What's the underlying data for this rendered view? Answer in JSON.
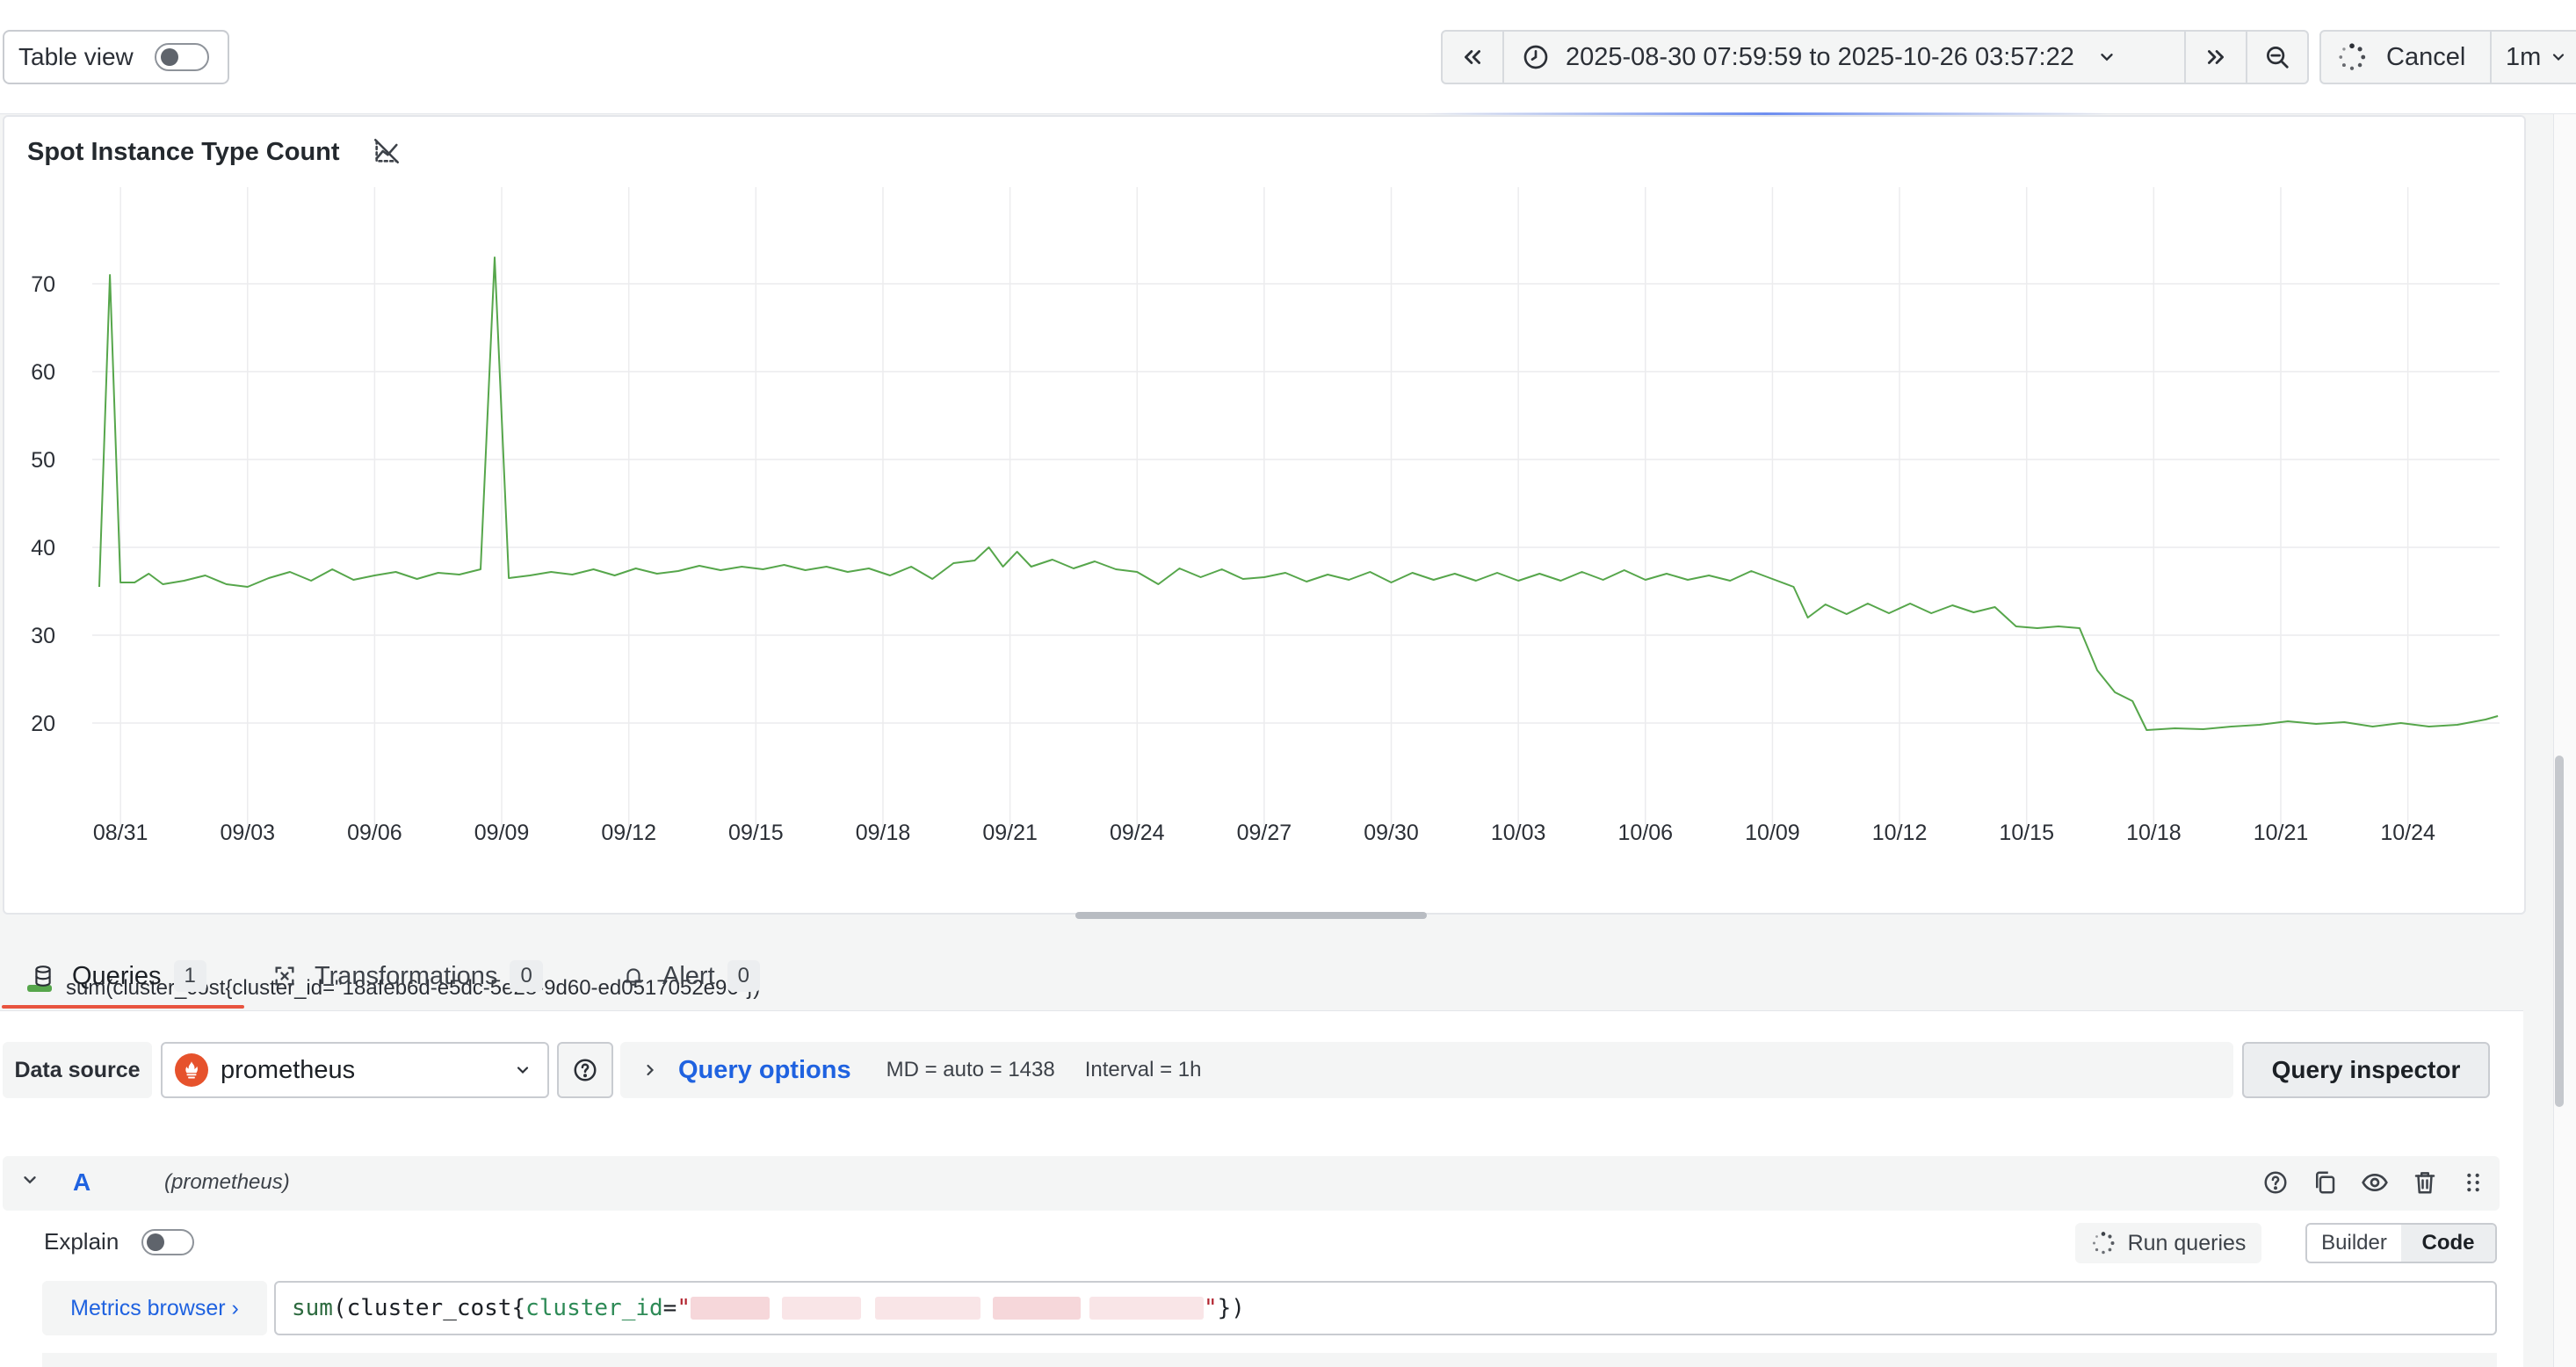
{
  "toolbar": {
    "table_view_label": "Table view",
    "time_range": "2025-08-30 07:59:59 to 2025-10-26 03:57:22",
    "cancel_label": "Cancel",
    "refresh_interval": "1m"
  },
  "panel": {
    "title": "Spot Instance Type Count",
    "legend_label": "sum(cluster_cost{cluster_id=\"18afeb6d-e5dc-5e28-9d60-ed0517052e96\"})"
  },
  "chart_data": {
    "type": "line",
    "x_ticks": [
      "08/31",
      "09/03",
      "09/06",
      "09/09",
      "09/12",
      "09/15",
      "09/18",
      "09/21",
      "09/24",
      "09/27",
      "09/30",
      "10/03",
      "10/06",
      "10/09",
      "10/12",
      "10/15",
      "10/18",
      "10/21",
      "10/24"
    ],
    "y_ticks": [
      20,
      30,
      40,
      50,
      60,
      70
    ],
    "ylim": [
      12,
      79
    ],
    "grid": true,
    "series": [
      {
        "name": "sum(cluster_cost{cluster_id=\"18afeb6d-e5dc-5e28-9d60-ed0517052e96\"})",
        "color": "#56a64b",
        "points": [
          [
            "08/30 12:00",
            35.5
          ],
          [
            "08/30 18:00",
            71
          ],
          [
            "08/31 00:00",
            36
          ],
          [
            "08/31 08:00",
            36
          ],
          [
            "08/31 16:00",
            37
          ],
          [
            "09/01 00:00",
            35.8
          ],
          [
            "09/01 12:00",
            36.2
          ],
          [
            "09/02 00:00",
            36.8
          ],
          [
            "09/02 12:00",
            35.8
          ],
          [
            "09/03 00:00",
            35.5
          ],
          [
            "09/03 12:00",
            36.5
          ],
          [
            "09/04 00:00",
            37.2
          ],
          [
            "09/04 12:00",
            36.2
          ],
          [
            "09/05 00:00",
            37.5
          ],
          [
            "09/05 12:00",
            36.3
          ],
          [
            "09/06 00:00",
            36.8
          ],
          [
            "09/06 12:00",
            37.2
          ],
          [
            "09/07 00:00",
            36.4
          ],
          [
            "09/07 12:00",
            37.1
          ],
          [
            "09/08 00:00",
            36.9
          ],
          [
            "09/08 12:00",
            37.5
          ],
          [
            "09/08 20:00",
            73
          ],
          [
            "09/09 04:00",
            36.5
          ],
          [
            "09/09 16:00",
            36.8
          ],
          [
            "09/10 04:00",
            37.2
          ],
          [
            "09/10 16:00",
            36.9
          ],
          [
            "09/11 04:00",
            37.5
          ],
          [
            "09/11 16:00",
            36.8
          ],
          [
            "09/12 04:00",
            37.6
          ],
          [
            "09/12 16:00",
            37.0
          ],
          [
            "09/13 04:00",
            37.3
          ],
          [
            "09/13 16:00",
            37.9
          ],
          [
            "09/14 04:00",
            37.4
          ],
          [
            "09/14 16:00",
            37.8
          ],
          [
            "09/15 04:00",
            37.5
          ],
          [
            "09/15 16:00",
            38
          ],
          [
            "09/16 04:00",
            37.4
          ],
          [
            "09/16 16:00",
            37.8
          ],
          [
            "09/17 04:00",
            37.2
          ],
          [
            "09/17 16:00",
            37.6
          ],
          [
            "09/18 04:00",
            36.8
          ],
          [
            "09/18 16:00",
            37.8
          ],
          [
            "09/19 04:00",
            36.4
          ],
          [
            "09/19 16:00",
            38.2
          ],
          [
            "09/20 04:00",
            38.5
          ],
          [
            "09/20 12:00",
            40
          ],
          [
            "09/20 20:00",
            37.8
          ],
          [
            "09/21 04:00",
            39.5
          ],
          [
            "09/21 12:00",
            37.8
          ],
          [
            "09/22 00:00",
            38.6
          ],
          [
            "09/22 12:00",
            37.6
          ],
          [
            "09/23 00:00",
            38.4
          ],
          [
            "09/23 12:00",
            37.5
          ],
          [
            "09/24 00:00",
            37.2
          ],
          [
            "09/24 12:00",
            35.8
          ],
          [
            "09/25 00:00",
            37.6
          ],
          [
            "09/25 12:00",
            36.6
          ],
          [
            "09/26 00:00",
            37.5
          ],
          [
            "09/26 12:00",
            36.4
          ],
          [
            "09/27 00:00",
            36.6
          ],
          [
            "09/27 12:00",
            37.1
          ],
          [
            "09/28 00:00",
            36.1
          ],
          [
            "09/28 12:00",
            36.9
          ],
          [
            "09/29 00:00",
            36.3
          ],
          [
            "09/29 12:00",
            37.2
          ],
          [
            "09/30 00:00",
            36.0
          ],
          [
            "09/30 12:00",
            37.1
          ],
          [
            "10/01 00:00",
            36.3
          ],
          [
            "10/01 12:00",
            37.0
          ],
          [
            "10/02 00:00",
            36.2
          ],
          [
            "10/02 12:00",
            37.1
          ],
          [
            "10/03 00:00",
            36.2
          ],
          [
            "10/03 12:00",
            37.0
          ],
          [
            "10/04 00:00",
            36.2
          ],
          [
            "10/04 12:00",
            37.2
          ],
          [
            "10/05 00:00",
            36.3
          ],
          [
            "10/05 12:00",
            37.4
          ],
          [
            "10/06 00:00",
            36.3
          ],
          [
            "10/06 12:00",
            37.0
          ],
          [
            "10/07 00:00",
            36.3
          ],
          [
            "10/07 12:00",
            36.8
          ],
          [
            "10/08 00:00",
            36.2
          ],
          [
            "10/08 12:00",
            37.3
          ],
          [
            "10/09 00:00",
            36.4
          ],
          [
            "10/09 12:00",
            35.5
          ],
          [
            "10/09 20:00",
            32
          ],
          [
            "10/10 06:00",
            33.5
          ],
          [
            "10/10 18:00",
            32.4
          ],
          [
            "10/11 06:00",
            33.6
          ],
          [
            "10/11 18:00",
            32.5
          ],
          [
            "10/12 06:00",
            33.6
          ],
          [
            "10/12 18:00",
            32.5
          ],
          [
            "10/13 06:00",
            33.4
          ],
          [
            "10/13 18:00",
            32.6
          ],
          [
            "10/14 06:00",
            33.2
          ],
          [
            "10/14 18:00",
            31
          ],
          [
            "10/15 06:00",
            30.8
          ],
          [
            "10/15 18:00",
            31
          ],
          [
            "10/16 06:00",
            30.8
          ],
          [
            "10/16 16:00",
            26
          ],
          [
            "10/17 02:00",
            23.5
          ],
          [
            "10/17 12:00",
            22.5
          ],
          [
            "10/17 20:00",
            19.2
          ],
          [
            "10/18 12:00",
            19.4
          ],
          [
            "10/19 04:00",
            19.3
          ],
          [
            "10/19 20:00",
            19.6
          ],
          [
            "10/20 12:00",
            19.8
          ],
          [
            "10/21 04:00",
            20.2
          ],
          [
            "10/21 20:00",
            19.9
          ],
          [
            "10/22 12:00",
            20.1
          ],
          [
            "10/23 04:00",
            19.6
          ],
          [
            "10/23 20:00",
            20.0
          ],
          [
            "10/24 12:00",
            19.6
          ],
          [
            "10/25 04:00",
            19.8
          ],
          [
            "10/25 20:00",
            20.4
          ],
          [
            "10/26 03:00",
            20.8
          ]
        ]
      }
    ]
  },
  "query_editor": {
    "tabs": [
      {
        "label": "Queries",
        "count": "1"
      },
      {
        "label": "Transformations",
        "count": "0"
      },
      {
        "label": "Alert",
        "count": "0"
      }
    ],
    "data_source_label": "Data source",
    "data_source_value": "prometheus",
    "query_options_label": "Query options",
    "md_info": "MD = auto = 1438",
    "interval_info": "Interval = 1h",
    "query_inspector_label": "Query inspector",
    "query_ref_id": "A",
    "query_ds_name": "(prometheus)",
    "explain_label": "Explain",
    "run_queries_label": "Run queries",
    "mode_builder": "Builder",
    "mode_code": "Code",
    "metrics_browser_label": "Metrics browser ›",
    "expr_fn": "sum",
    "expr_metric": "cluster_cost{",
    "expr_label": "cluster_id",
    "expr_close": "})"
  },
  "icons": {
    "shift_left": "chevron-double-left-icon",
    "clock": "clock-icon",
    "shift_right": "chevron-double-right-icon",
    "zoom_out": "zoom-out-icon",
    "spinner": "spinner-icon",
    "no_hover": "graph-hover-off-icon"
  }
}
